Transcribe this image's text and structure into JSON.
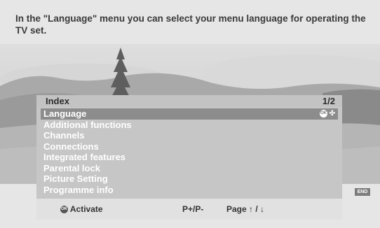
{
  "caption": "In the \"Language\" menu you can select your menu language for operating the TV set.",
  "menu": {
    "title": "Index",
    "page": "1/2",
    "items": [
      {
        "label": "Language"
      },
      {
        "label": "Additional functions"
      },
      {
        "label": "Channels"
      },
      {
        "label": "Connections"
      },
      {
        "label": "Integrated features"
      },
      {
        "label": "Parental lock"
      },
      {
        "label": "Picture Setting"
      },
      {
        "label": "Programme info"
      }
    ],
    "selected_index": 0,
    "selected_hint": "OK ✣"
  },
  "buttons": {
    "end": "END",
    "ok": "OK"
  },
  "footer": {
    "activate": "Activate",
    "pp": "P+/P-",
    "page": "Page ↑ / ↓"
  },
  "colors": {
    "selection": "#8c8c8c",
    "menu_bg": "#c6c6c6",
    "background": "#e6e6e6"
  }
}
